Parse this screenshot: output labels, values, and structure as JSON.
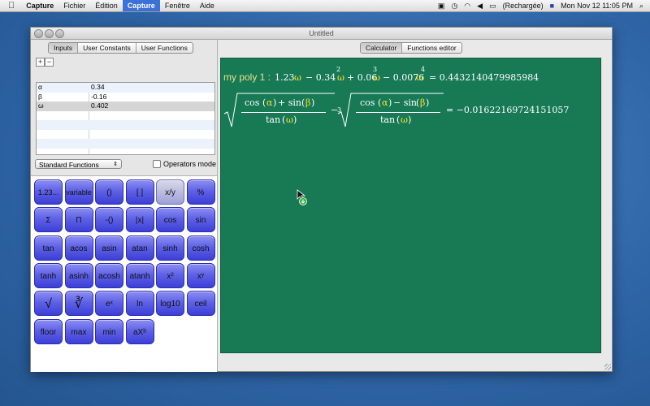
{
  "menubar": {
    "app": "Capture",
    "items": [
      "Fichier",
      "Édition",
      "Capture",
      "Fenêtre",
      "Aide"
    ],
    "battery_label": "(Rechargée)",
    "clock": "Mon Nov 12  11:05 PM"
  },
  "window": {
    "title": "Untitled"
  },
  "left_tabs": [
    "Inputs",
    "User Constants",
    "User Functions"
  ],
  "right_tabs": [
    "Calculator",
    "Functions editor"
  ],
  "add_label": "+",
  "remove_label": "−",
  "variables": [
    {
      "name": "α",
      "value": "0.34"
    },
    {
      "name": "β",
      "value": "-0.16"
    },
    {
      "name": "ω",
      "value": "0.402"
    }
  ],
  "functions_popup": "Standard Functions",
  "operators_mode_label": "Operators mode",
  "keys": [
    [
      "1.23...",
      "variable",
      "()",
      "[ ]",
      "x/y",
      "%"
    ],
    [
      "Σ",
      "Π",
      "-()",
      "|x|",
      "cos",
      "sin"
    ],
    [
      "tan",
      "acos",
      "asin",
      "atan",
      "sinh",
      "cosh"
    ],
    [
      "tanh",
      "asinh",
      "acosh",
      "atanh",
      "x²",
      "xʸ"
    ],
    [
      "√",
      "∛",
      "eˣ",
      "ln",
      "log10",
      "ceil"
    ],
    [
      "floor",
      "max",
      "min",
      "aXᵇ"
    ]
  ],
  "expr1": {
    "label": "my poly 1 :",
    "t1_coef": "1.23",
    "t2_coef": "− 0.34",
    "t3_coef": "+ 0.06",
    "t4_coef": "− 0.0076",
    "var": "ω",
    "exp2": "2",
    "exp3": "3",
    "exp4": "4",
    "result": "= 0.4432140479985984"
  },
  "expr2": {
    "num1_a": "cos",
    "num1_b": "+ sin",
    "num2_a": "cos",
    "num2_b": "− sin",
    "alpha": "α",
    "beta": "β",
    "den": "tan",
    "omega": "ω",
    "minus": "−",
    "cube": "3",
    "result": "= −0.01622169724151057"
  },
  "colors": {
    "calculator_bg": "#177a55",
    "key_blue": "#5f62e6",
    "highlight": "#ffe02a"
  }
}
